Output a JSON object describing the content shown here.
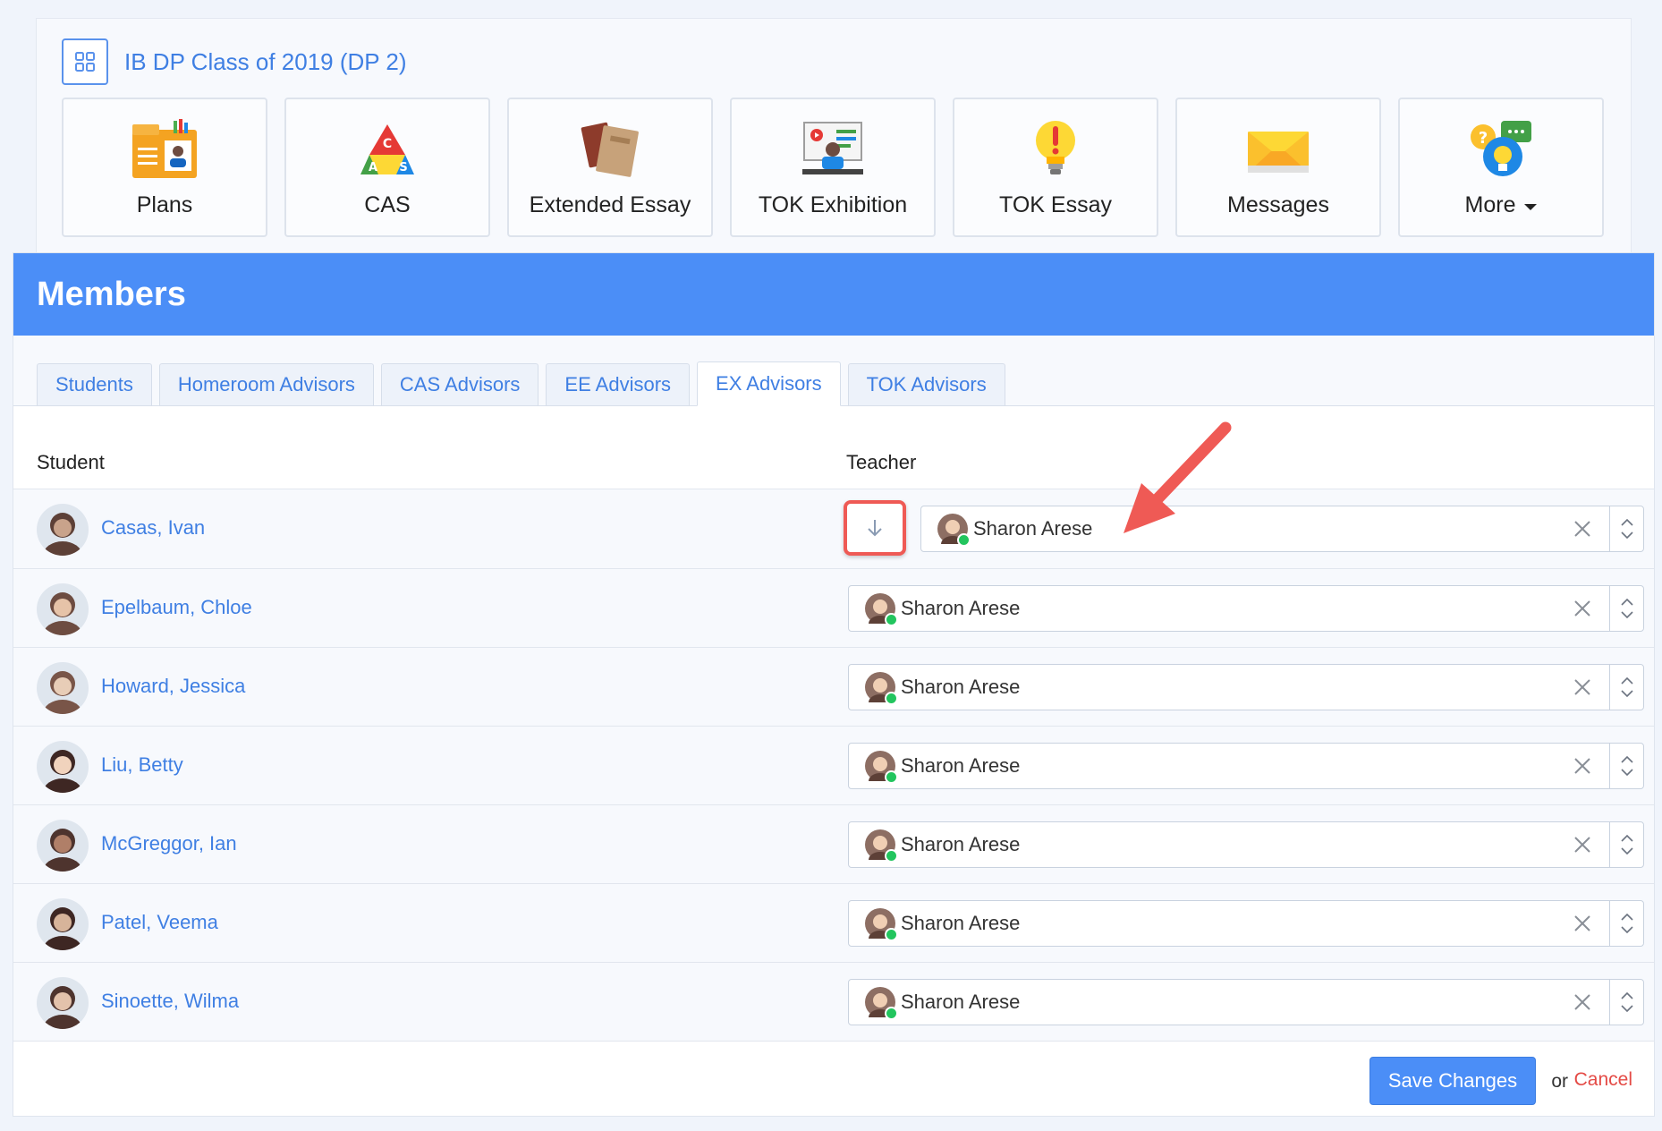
{
  "class_header": {
    "title": "IB DP Class of 2019 (DP 2)"
  },
  "tiles": [
    {
      "label": "Plans",
      "icon": "plans-folder-icon"
    },
    {
      "label": "CAS",
      "icon": "cas-triangle-icon"
    },
    {
      "label": "Extended Essay",
      "icon": "books-icon"
    },
    {
      "label": "TOK Exhibition",
      "icon": "presentation-icon"
    },
    {
      "label": "TOK Essay",
      "icon": "lightbulb-icon"
    },
    {
      "label": "Messages",
      "icon": "envelope-icon"
    },
    {
      "label": "More",
      "icon": "help-chat-icon"
    }
  ],
  "members": {
    "title": "Members",
    "tabs": [
      "Students",
      "Homeroom Advisors",
      "CAS Advisors",
      "EE Advisors",
      "EX Advisors",
      "TOK Advisors"
    ],
    "active_tab": "EX Advisors",
    "columns": {
      "student": "Student",
      "teacher": "Teacher"
    },
    "rows": [
      {
        "student": "Casas, Ivan",
        "teacher": "Sharon Arese"
      },
      {
        "student": "Epelbaum, Chloe",
        "teacher": "Sharon Arese"
      },
      {
        "student": "Howard, Jessica",
        "teacher": "Sharon Arese"
      },
      {
        "student": "Liu, Betty",
        "teacher": "Sharon Arese"
      },
      {
        "student": "McGreggor, Ian",
        "teacher": "Sharon Arese"
      },
      {
        "student": "Patel, Veema",
        "teacher": "Sharon Arese"
      },
      {
        "student": "Sinoette, Wilma",
        "teacher": "Sharon Arese"
      }
    ],
    "footer": {
      "save_label": "Save Changes",
      "or_label": "or",
      "cancel_label": "Cancel"
    }
  },
  "colors": {
    "accent": "#4b8ef7",
    "link": "#3f7fe3",
    "danger": "#e44a45",
    "online": "#22c55e",
    "highlight": "#ef5a55"
  }
}
